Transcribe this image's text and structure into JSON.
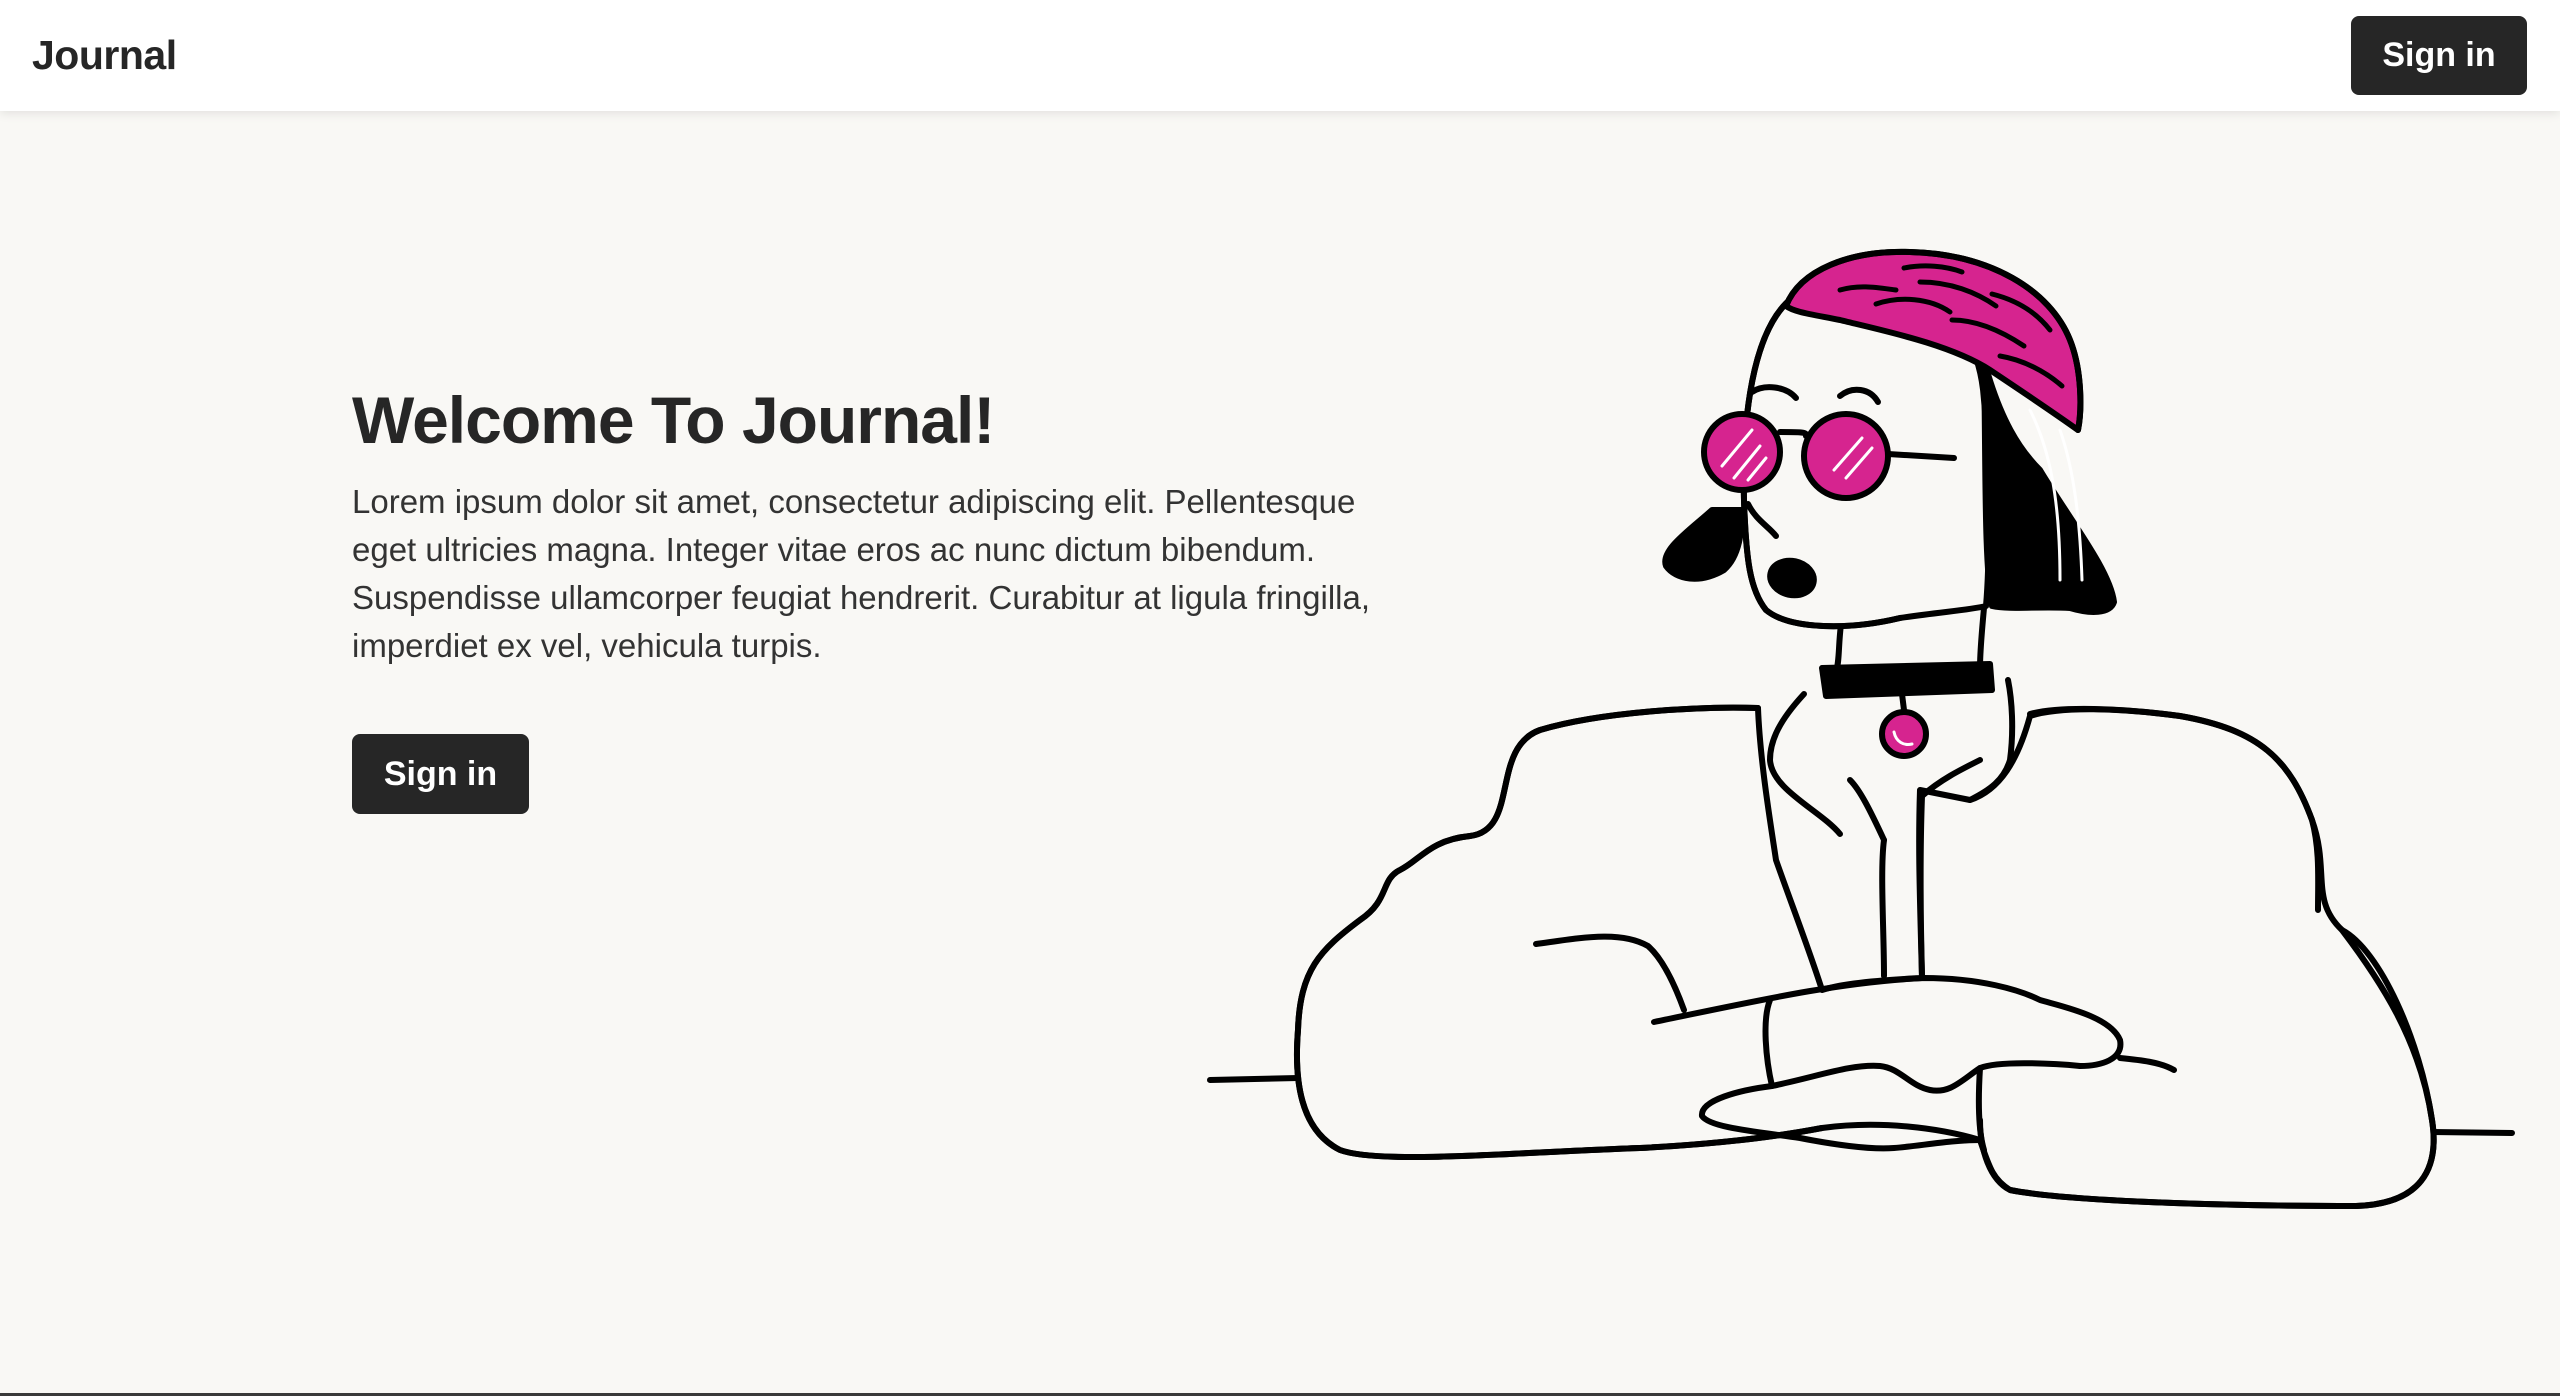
{
  "header": {
    "brand": "Journal",
    "signin_label": "Sign in"
  },
  "hero": {
    "title": "Welcome To Journal!",
    "body": "Lorem ipsum dolor sit amet, consectetur adipiscing elit. Pellentesque eget ultricies magna. Integer vitae eros ac nunc dictum bibendum. Suspendisse ullamcorper feugiat hendrerit. Curabitur at ligula fringilla, imperdiet ex vel, vehicula turpis.",
    "signin_label": "Sign in"
  },
  "illustration": {
    "accent_color": "#d6248f",
    "line_color": "#000000",
    "fill_color": "#f9f8f5"
  }
}
